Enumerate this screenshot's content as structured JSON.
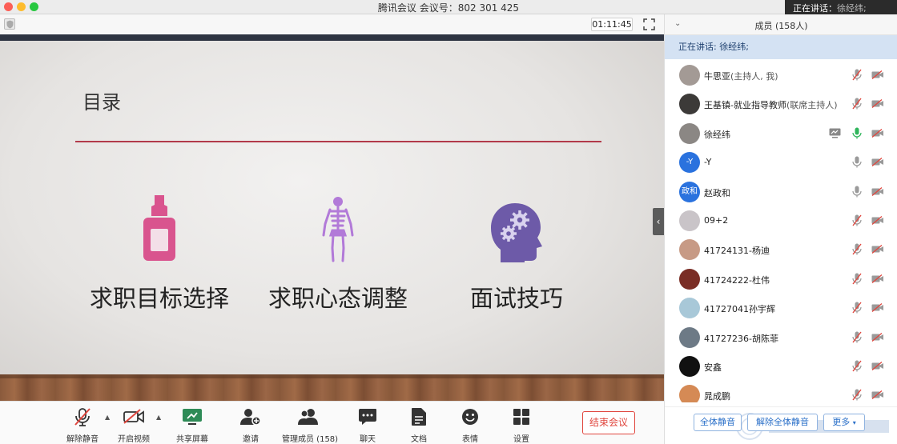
{
  "window": {
    "title": "腾讯会议 会议号：802 301 425"
  },
  "toast": {
    "prefix": "正在讲话：",
    "name": "徐经纬;"
  },
  "video_toolbar": {
    "timer": "01:11:45"
  },
  "slide": {
    "title": "目录",
    "items": [
      {
        "label": "求职目标选择",
        "icon": "glue-bottle-icon",
        "color": "#d9548e"
      },
      {
        "label": "求职心态调整",
        "icon": "skeleton-icon",
        "color": "#b27ad8"
      },
      {
        "label": "面试技巧",
        "icon": "head-gears-icon",
        "color": "#6d5aa8"
      }
    ],
    "line_color": "#b23a4a"
  },
  "bottom_toolbar": {
    "unmute": "解除静音",
    "start_video": "开启视频",
    "share_screen": "共享屏幕",
    "invite": "邀请",
    "manage_members": "管理成员 (158)",
    "chat": "聊天",
    "docs": "文档",
    "emoji": "表情",
    "settings": "设置",
    "end_meeting": "结束会议"
  },
  "panel": {
    "title": "成员 (158人)",
    "speaking": "正在讲话: 徐经纬;",
    "members": [
      {
        "name": "牛思亚",
        "role": "(主持人, 我)",
        "avatar_color": "#a39a95",
        "initials": "",
        "mic": "muted",
        "share": false
      },
      {
        "name": "王基镇-就业指导教师",
        "role": "(联席主持人)",
        "avatar_color": "#3c3a38",
        "initials": "",
        "mic": "muted",
        "share": false
      },
      {
        "name": "徐经纬",
        "role": "",
        "avatar_color": "#8b8784",
        "initials": "",
        "mic": "on",
        "share": true
      },
      {
        "name": "-Y",
        "role": "",
        "avatar_color": "#2a72de",
        "initials": "-Y",
        "mic": "off",
        "share": false
      },
      {
        "name": "赵政和",
        "role": "",
        "avatar_color": "#2a72de",
        "initials": "政和",
        "mic": "off",
        "share": false
      },
      {
        "name": "09+2",
        "role": "",
        "avatar_color": "#c9c4c8",
        "initials": "",
        "mic": "muted",
        "share": false
      },
      {
        "name": "41724131-杨迪",
        "role": "",
        "avatar_color": "#c79a85",
        "initials": "",
        "mic": "muted",
        "share": false
      },
      {
        "name": "41724222-杜伟",
        "role": "",
        "avatar_color": "#7a2d25",
        "initials": "",
        "mic": "muted",
        "share": false
      },
      {
        "name": "41727041孙宇辉",
        "role": "",
        "avatar_color": "#a8c8d8",
        "initials": "",
        "mic": "muted",
        "share": false
      },
      {
        "name": "41727236-胡陈菲",
        "role": "",
        "avatar_color": "#6d7a86",
        "initials": "",
        "mic": "muted",
        "share": false
      },
      {
        "name": "安鑫",
        "role": "",
        "avatar_color": "#111111",
        "initials": "",
        "mic": "muted",
        "share": false
      },
      {
        "name": "晁成鹏",
        "role": "",
        "avatar_color": "#d58a55",
        "initials": "",
        "mic": "muted",
        "share": false
      }
    ],
    "mute_all": "全体静音",
    "unmute_all": "解除全体静音",
    "more": "更多"
  }
}
